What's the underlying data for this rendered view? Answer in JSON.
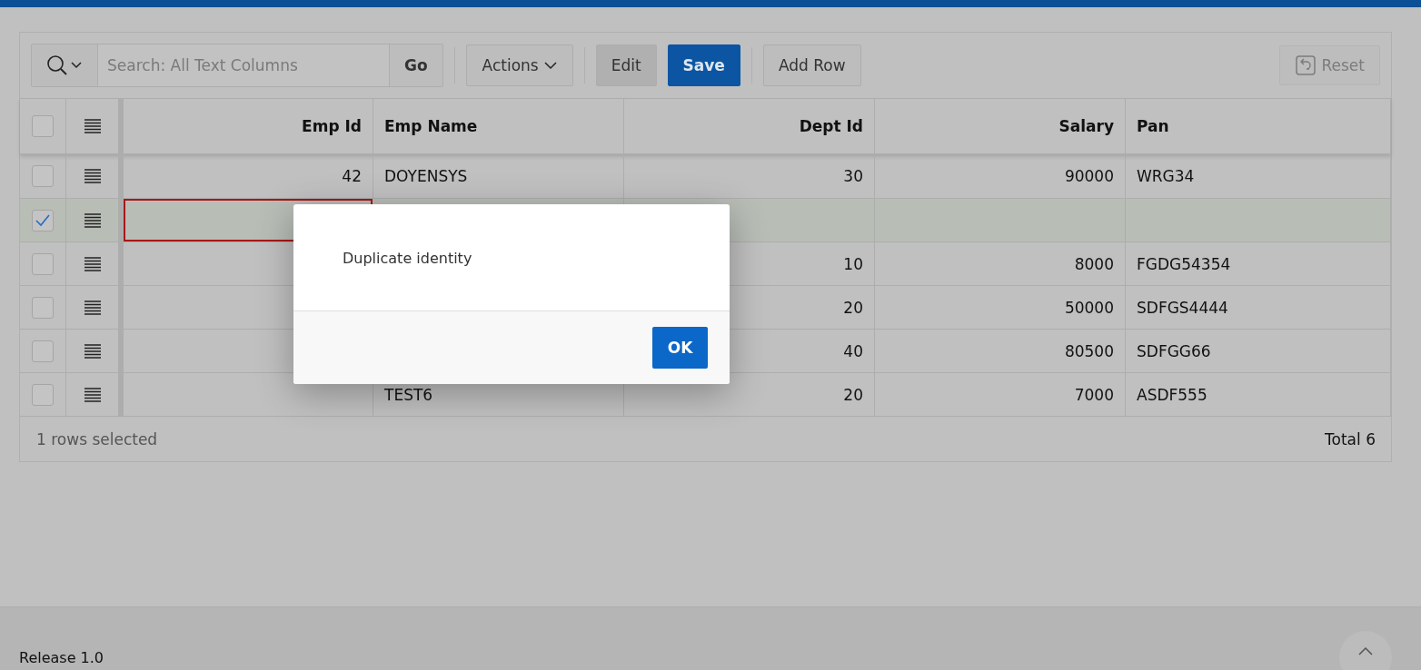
{
  "toolbar": {
    "search": {
      "placeholder": "Search: All Text Columns"
    },
    "go": "Go",
    "actions": "Actions",
    "edit": {
      "label": "Edit",
      "pressed": true
    },
    "save": "Save",
    "add_row": "Add Row",
    "reset": {
      "label": "Reset",
      "disabled": true
    }
  },
  "grid": {
    "select_all_checked": false,
    "columns": [
      "Emp Id",
      "Emp Name",
      "Dept Id",
      "Salary",
      "Pan"
    ],
    "rows": [
      {
        "selected": false,
        "invalid": false,
        "cells": [
          "42",
          "DOYENSYS",
          "30",
          "90000",
          "WRG34"
        ]
      },
      {
        "selected": true,
        "invalid": true,
        "cells": [
          null,
          null,
          null,
          null,
          null
        ]
      },
      {
        "selected": false,
        "invalid": false,
        "cells": [
          null,
          null,
          "10",
          "8000",
          "FGDG54354"
        ]
      },
      {
        "selected": false,
        "invalid": false,
        "cells": [
          null,
          null,
          "20",
          "50000",
          "SDFGS4444"
        ]
      },
      {
        "selected": false,
        "invalid": false,
        "cells": [
          null,
          null,
          "40",
          "80500",
          "SDFGG66"
        ]
      },
      {
        "selected": false,
        "invalid": false,
        "cells": [
          null,
          "TEST6",
          "20",
          "7000",
          "ASDF555"
        ]
      }
    ],
    "footer": {
      "selection": "1 rows selected",
      "total": "Total 6"
    }
  },
  "dialog": {
    "message": "Duplicate identity",
    "button": "OK"
  },
  "page_footer": {
    "release": "Release 1.0"
  }
}
